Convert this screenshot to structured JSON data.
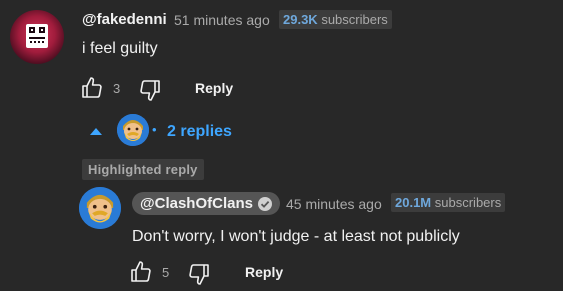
{
  "top_comment": {
    "author": "@fakedenni",
    "time": "51 minutes ago",
    "subscriber_count": "29.3K",
    "subscriber_label": "subscribers",
    "text": "i feel guilty",
    "like_count": "3",
    "reply_label": "Reply",
    "replies_toggle": "2 replies",
    "replies_separator": "•"
  },
  "highlighted_label": "Highlighted reply",
  "reply_comment": {
    "author": "@ClashOfClans",
    "time": "45 minutes ago",
    "subscriber_count": "20.1M",
    "subscriber_label": "subscribers",
    "text": "Don't worry, I won't judge - at least not publicly",
    "like_count": "5",
    "reply_label": "Reply"
  },
  "colors": {
    "background": "#282828",
    "link_blue": "#3ea6ff",
    "badge_bg": "#3c3c3c",
    "subs_number": "#6fa8dc"
  },
  "icons": [
    "thumbs-up-icon",
    "thumbs-down-icon",
    "chevron-up-icon",
    "verified-check-icon"
  ]
}
